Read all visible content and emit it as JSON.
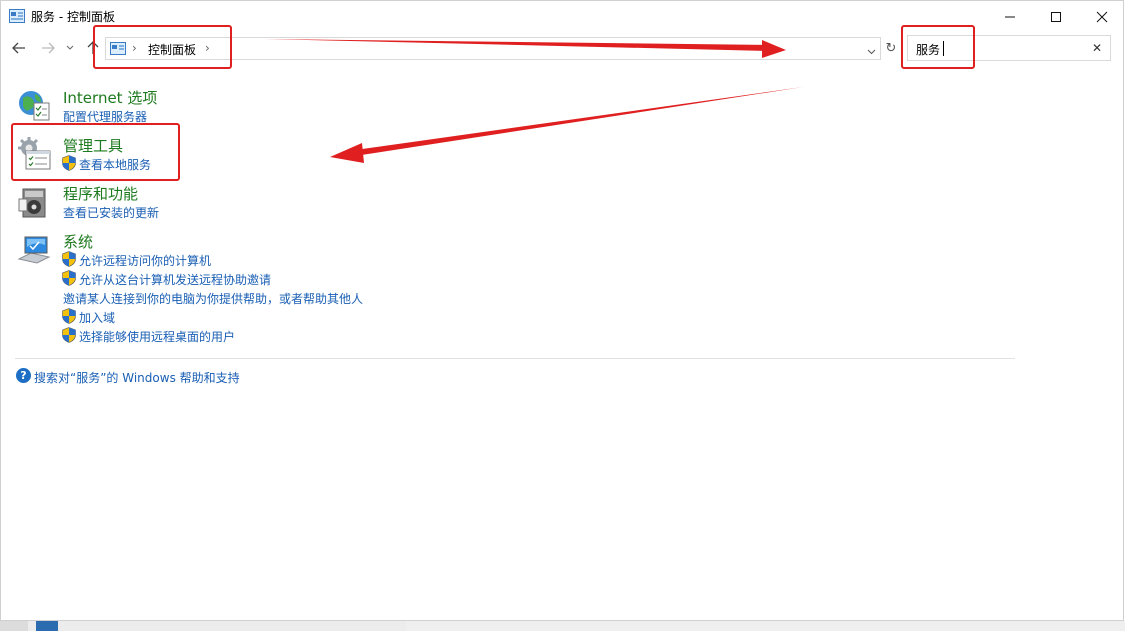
{
  "window": {
    "title": "服务 - 控制面板",
    "controls": {
      "minimize_icon": "minimize-icon",
      "maximize_icon": "maximize-icon",
      "close_icon": "close-icon"
    }
  },
  "navigation": {
    "back_icon": "arrow-left-icon",
    "forward_icon": "arrow-right-icon",
    "recent_icon": "chevron-down-icon",
    "up_icon": "arrow-up-icon"
  },
  "address_bar": {
    "crumbs": [
      "控制面板"
    ],
    "dropdown_icon": "chevron-down-icon",
    "refresh_icon": "refresh-icon"
  },
  "search": {
    "value": "服务",
    "clear_glyph": "✕"
  },
  "results": [
    {
      "heading": "Internet 选项",
      "icon": "internet-options-icon",
      "links": [
        {
          "text": "配置代理服务器",
          "shield": false
        }
      ]
    },
    {
      "heading": "管理工具",
      "icon": "admin-tools-icon",
      "links": [
        {
          "text": "查看本地服务",
          "shield": true
        }
      ]
    },
    {
      "heading": "程序和功能",
      "icon": "programs-features-icon",
      "links": [
        {
          "text": "查看已安装的更新",
          "shield": false
        }
      ]
    },
    {
      "heading": "系统",
      "icon": "system-icon",
      "links": [
        {
          "text": "允许远程访问你的计算机",
          "shield": true
        },
        {
          "text": "允许从这台计算机发送远程协助邀请",
          "shield": true
        },
        {
          "text": "邀请某人连接到你的电脑为你提供帮助，或者帮助其他人",
          "shield": false
        },
        {
          "text": "加入域",
          "shield": true
        },
        {
          "text": "选择能够使用远程桌面的用户",
          "shield": true
        }
      ]
    }
  ],
  "help_link": "搜索对“服务”的 Windows 帮助和支持",
  "colors": {
    "heading": "#1e7a1e",
    "link": "#1a5fb4",
    "annotation_red": "#e02020"
  }
}
